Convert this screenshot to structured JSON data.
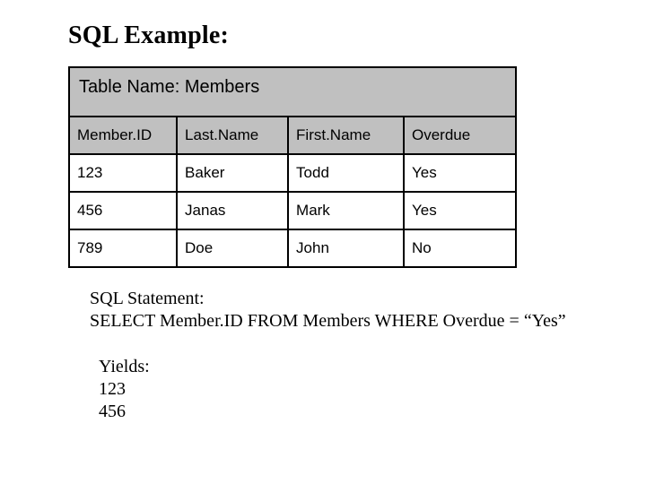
{
  "title": "SQL Example:",
  "table_label_prefix": "Table Name:  ",
  "table_name": "Members",
  "columns": [
    "Member.ID",
    "Last.Name",
    "First.Name",
    "Overdue"
  ],
  "rows": [
    [
      "123",
      "Baker",
      "Todd",
      "Yes"
    ],
    [
      "456",
      "Janas",
      "Mark",
      "Yes"
    ],
    [
      "789",
      "Doe",
      "John",
      "No"
    ]
  ],
  "sql_label": "SQL Statement:",
  "sql_statement": "SELECT Member.ID FROM Members WHERE Overdue = “Yes”",
  "yields_label": "Yields:",
  "yields": [
    "123",
    "456"
  ],
  "chart_data": {
    "type": "table",
    "title": "Members",
    "columns": [
      "Member.ID",
      "Last.Name",
      "First.Name",
      "Overdue"
    ],
    "rows": [
      {
        "Member.ID": "123",
        "Last.Name": "Baker",
        "First.Name": "Todd",
        "Overdue": "Yes"
      },
      {
        "Member.ID": "456",
        "Last.Name": "Janas",
        "First.Name": "Mark",
        "Overdue": "Yes"
      },
      {
        "Member.ID": "789",
        "Last.Name": "Doe",
        "First.Name": "John",
        "Overdue": "No"
      }
    ]
  }
}
